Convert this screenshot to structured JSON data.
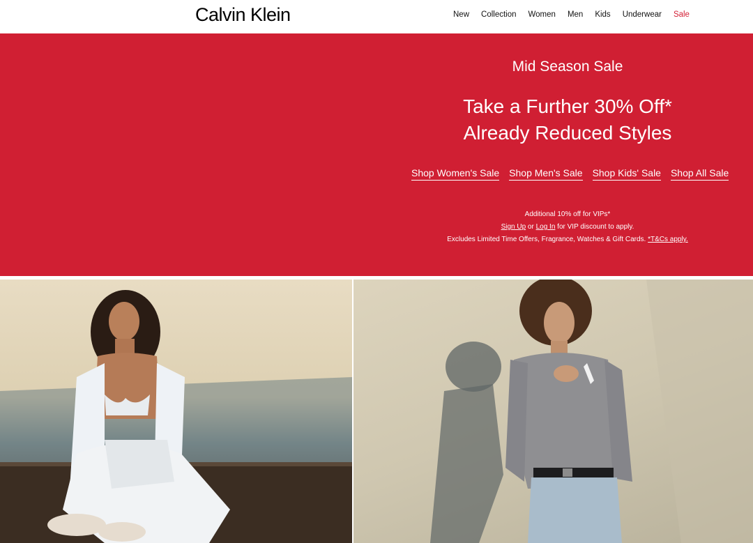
{
  "brand": {
    "logo_text": "Calvin Klein"
  },
  "nav": {
    "items": [
      {
        "label": "New"
      },
      {
        "label": "Collection"
      },
      {
        "label": "Women"
      },
      {
        "label": "Men"
      },
      {
        "label": "Kids"
      },
      {
        "label": "Underwear"
      },
      {
        "label": "Sale",
        "accent": "#d31f35"
      }
    ]
  },
  "hero": {
    "background_color": "#d01f33",
    "kicker": "Mid Season Sale",
    "headline_line1": "Take a Further 30% Off*",
    "headline_line2": "Already Reduced Styles",
    "ctas": [
      {
        "label": "Shop Women's Sale"
      },
      {
        "label": "Shop Men's Sale"
      },
      {
        "label": "Shop Kids' Sale"
      },
      {
        "label": "Shop All Sale"
      }
    ],
    "fine_print": {
      "line1": "Additional 10% off for VIPs*",
      "sign_up": "Sign Up",
      "or": " or ",
      "log_in": "Log In",
      "line2_rest": " for VIP discount to apply.",
      "line3": "Excludes Limited Time Offers, Fragrance, Watches & Gift Cards. ",
      "terms": "*T&Cs apply."
    }
  },
  "images": {
    "left": {
      "icon": "womens-lingerie-photo"
    },
    "right": {
      "icon": "womens-top-photo"
    }
  }
}
